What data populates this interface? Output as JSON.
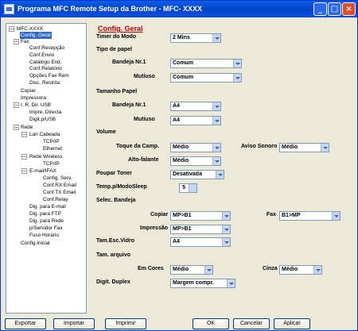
{
  "window": {
    "title": "Programa MFC Remote Setup da Brother - MFC- XXXX"
  },
  "tree": [
    {
      "label": "MFC-XXXX"
    },
    {
      "label": "Config. Geral"
    },
    {
      "label": "Fax"
    },
    {
      "label": "Conf.Recepção"
    },
    {
      "label": "Conf.Envio"
    },
    {
      "label": "Catálogo End."
    },
    {
      "label": "Conf.Relatório"
    },
    {
      "label": "Opções Fax Rem"
    },
    {
      "label": "Disc. Restrita"
    },
    {
      "label": "Copiar"
    },
    {
      "label": "Impressora"
    },
    {
      "label": "I. R. Dir. USB"
    },
    {
      "label": "Impre. Directa"
    },
    {
      "label": "Digit.p/USB"
    },
    {
      "label": "Rede"
    },
    {
      "label": "Lan Cabeada"
    },
    {
      "label": "TCP/IP"
    },
    {
      "label": "Ethernet"
    },
    {
      "label": "Rede Wireless"
    },
    {
      "label": "TCP/IP"
    },
    {
      "label": "E-mail/IFAX"
    },
    {
      "label": "Config. Serv."
    },
    {
      "label": "Conf.RX Email"
    },
    {
      "label": "Conf.TX Email"
    },
    {
      "label": "Conf.Relay"
    },
    {
      "label": "Dig. para E-mail"
    },
    {
      "label": "Dig. para FTP"
    },
    {
      "label": "Dig. para Rede"
    },
    {
      "label": "p/Servidor Fax"
    },
    {
      "label": "Fuso Horário"
    },
    {
      "label": "Config.Inicial"
    }
  ],
  "main": {
    "title": "Config. Geral",
    "timer_modo": {
      "label": "Timer do Modo",
      "value": "2 Mins"
    },
    "tipo_papel": {
      "heading": "Tipo de papel",
      "bandeja1": {
        "label": "Bandeja Nr.1",
        "value": "Comum"
      },
      "mutiuso": {
        "label": "Mutiuso",
        "value": "Comum"
      }
    },
    "tamanho_papel": {
      "heading": "Tamanho Papel",
      "bandeja1": {
        "label": "Bandeja Nr.1",
        "value": "A4"
      },
      "mutiuso": {
        "label": "Mutiuso",
        "value": "A4"
      }
    },
    "volume": {
      "heading": "Volume",
      "toque": {
        "label": "Toque da Camp.",
        "value": "Médio"
      },
      "aviso": {
        "label": "Aviso Sonoro",
        "value": "Médio"
      },
      "altofalante": {
        "label": "Alto-falante",
        "value": "Médio"
      }
    },
    "poupar_toner": {
      "label": "Poupar Toner",
      "value": "Desativada"
    },
    "modo_sleep": {
      "label": "Temp.p/ModoSleep",
      "value": "5"
    },
    "selec_bandeja": {
      "heading": "Selec. Bandeja",
      "copiar": {
        "label": "Copiar",
        "value": "MP>B1"
      },
      "fax": {
        "label": "Fax",
        "value": "B1>MP"
      },
      "impressao": {
        "label": "Impressão",
        "value": "MP>B1"
      }
    },
    "tam_esc_vidro": {
      "label": "Tam.Esc.Vidro",
      "value": "A4"
    },
    "tam_arquivo": {
      "heading": "Tam. arquivo",
      "em_cores": {
        "label": "Em Cores",
        "value": "Médio"
      },
      "cinza": {
        "label": "Cinza",
        "value": "Médio"
      }
    },
    "digit_duplex": {
      "label": "Digit. Duplex",
      "value": "Margem compr."
    }
  },
  "buttons": {
    "exportar": "Exportar",
    "importar": "Importar",
    "imprimir": "Imprimir",
    "ok": "OK",
    "cancelar": "Cancelar",
    "aplicar": "Aplicar"
  }
}
